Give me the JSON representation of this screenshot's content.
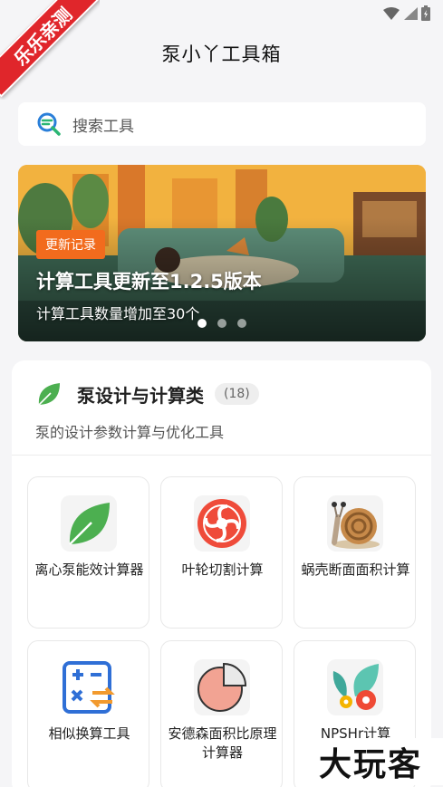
{
  "ribbon": {
    "text": "乐乐亲测"
  },
  "header": {
    "title": "泵小丫工具箱"
  },
  "search": {
    "placeholder": "搜索工具"
  },
  "banner": {
    "tag": "更新记录",
    "headline": "计算工具更新至1.2.5版本",
    "subtitle": "计算工具数量增加至30个",
    "slide_count": 3,
    "active_slide": 1
  },
  "category": {
    "title": "泵设计与计算类",
    "count": "(18)",
    "description": "泵的设计参数计算与优化工具",
    "icon": "leaf-icon",
    "tools": [
      {
        "label": "离心泵能效计算器",
        "icon": "leaf-icon"
      },
      {
        "label": "叶轮切割计算",
        "icon": "impeller-icon"
      },
      {
        "label": "蜗壳断面面积计算",
        "icon": "snail-icon"
      },
      {
        "label": "相似换算工具",
        "icon": "calculator-icon"
      },
      {
        "label": "安德森面积比原理计算器",
        "icon": "pie-chart-icon"
      },
      {
        "label": "NPSHr计算",
        "icon": "gears-leaf-icon"
      }
    ]
  },
  "watermark": {
    "text": "大玩客"
  },
  "colors": {
    "accent_orange": "#f26b1d",
    "ribbon_red": "#e0262b",
    "leaf_green": "#4caf50"
  }
}
